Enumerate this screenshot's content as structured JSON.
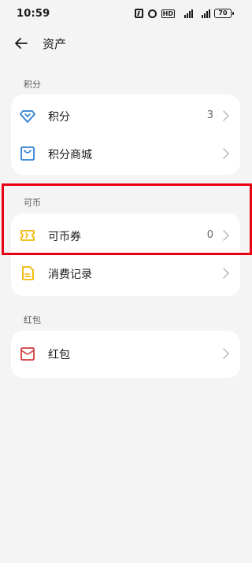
{
  "status_bar": {
    "time": "10:59",
    "battery": "70",
    "icons": [
      "nfc-icon",
      "alarm-icon",
      "hd-icon",
      "signal-icon",
      "signal-icon",
      "battery-icon"
    ]
  },
  "header": {
    "back_icon": "back-arrow-icon",
    "title": "资产"
  },
  "sections": {
    "points": {
      "label": "积分",
      "items": [
        {
          "label": "积分",
          "value": "3",
          "icon": "diamond-icon",
          "icon_color": "#2f7fd3"
        },
        {
          "label": "积分商城",
          "value": "",
          "icon": "shopping-bag-icon",
          "icon_color": "#2f7fd3"
        }
      ]
    },
    "coins": {
      "label": "可币",
      "items": [
        {
          "label": "可币券",
          "value": "0",
          "icon": "ticket-icon",
          "icon_color": "#f2b600"
        },
        {
          "label": "消费记录",
          "value": "",
          "icon": "document-icon",
          "icon_color": "#f2b600"
        }
      ]
    },
    "redpacket": {
      "label": "红包",
      "items": [
        {
          "label": "红包",
          "value": "",
          "icon": "envelope-icon",
          "icon_color": "#d33b3b"
        }
      ]
    }
  },
  "colors": {
    "background": "#f4f4f4",
    "card": "#ffffff",
    "highlight": "#e60012"
  }
}
